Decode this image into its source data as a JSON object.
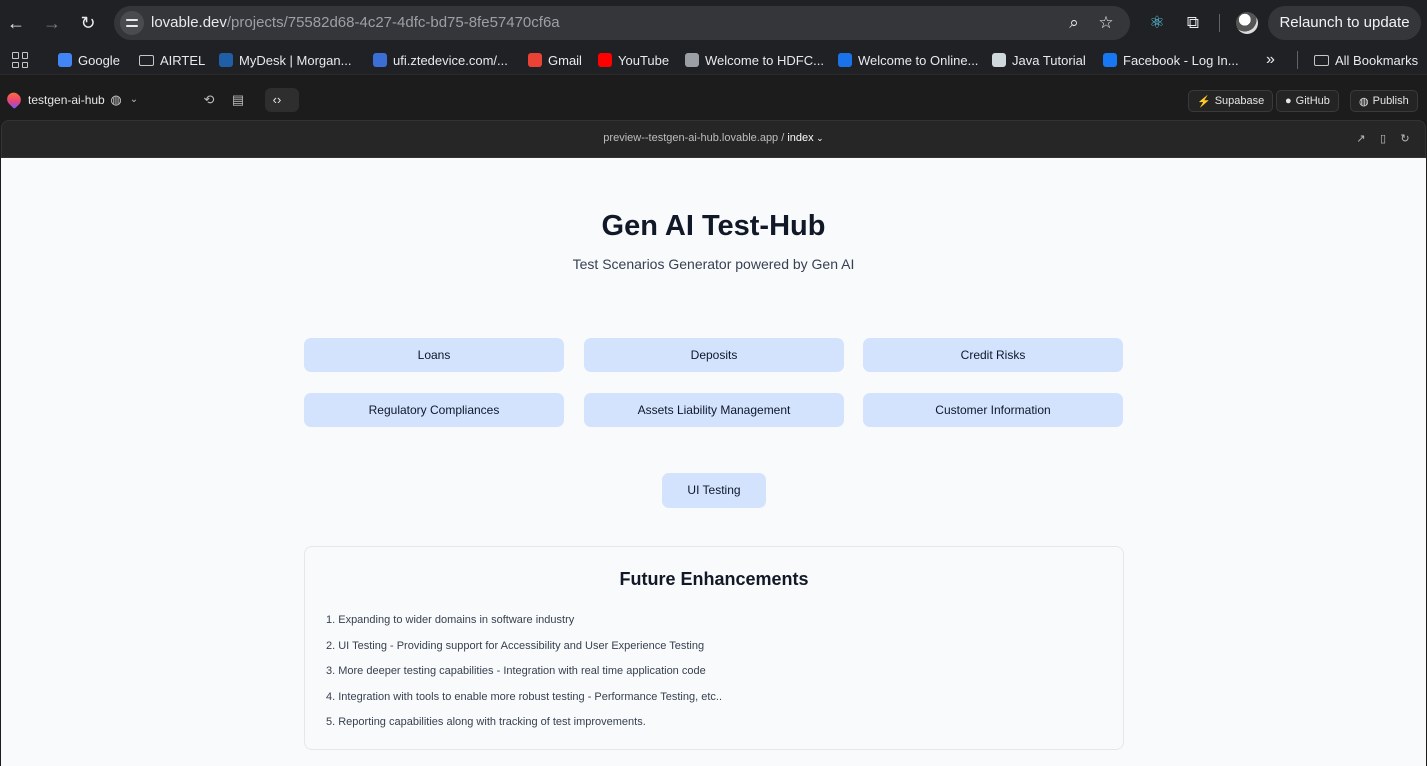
{
  "browser": {
    "url_host": "lovable.dev",
    "url_path": "/projects/75582d68-4c27-4dfc-bd75-8fe57470cf6a",
    "relaunch_label": "Relaunch to update"
  },
  "bookmarks": [
    {
      "label": "Google",
      "color": "#4285f4"
    },
    {
      "label": "AIRTEL",
      "folder": true
    },
    {
      "label": "MyDesk | Morgan...",
      "color": "#1f5fa8"
    },
    {
      "label": "ufi.ztedevice.com/...",
      "color": "#3b6fd6"
    },
    {
      "label": "Gmail",
      "color": "#ea4335"
    },
    {
      "label": "YouTube",
      "color": "#ff0000"
    },
    {
      "label": "Welcome to HDFC...",
      "color": "#9aa0a6"
    },
    {
      "label": "Welcome to Online...",
      "color": "#1a73e8"
    },
    {
      "label": "Java Tutorial",
      "color": "#cfd8dc"
    },
    {
      "label": "Facebook - Log In...",
      "color": "#1877f2"
    }
  ],
  "all_bookmarks_label": "All Bookmarks",
  "lovable": {
    "project_name": "testgen-ai-hub",
    "supabase_label": "Supabase",
    "github_label": "GitHub",
    "publish_label": "Publish"
  },
  "preview": {
    "host": "preview--testgen-ai-hub.lovable.app /",
    "page": "index"
  },
  "app": {
    "title": "Gen AI Test-Hub",
    "subtitle": "Test Scenarios Generator powered by Gen AI",
    "domains": [
      "Loans",
      "Deposits",
      "Credit Risks",
      "Regulatory Compliances",
      "Assets Liability Management",
      "Customer Information"
    ],
    "ui_testing_label": "UI Testing",
    "future": {
      "title": "Future Enhancements",
      "items": [
        "1. Expanding to wider domains in software industry",
        "2. UI Testing - Providing support for Accessibility and User Experience Testing",
        "3. More deeper testing capabilities - Integration with real time application code",
        "4. Integration with tools to enable more robust testing - Performance Testing, etc..",
        "5. Reporting capabilities along with tracking of test improvements."
      ]
    }
  }
}
